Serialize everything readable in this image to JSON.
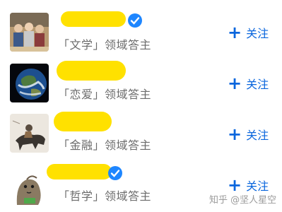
{
  "users": [
    {
      "tag": "「文学」领域答主",
      "verified": true
    },
    {
      "tag": "「恋爱」领域答主",
      "verified": false
    },
    {
      "tag": "「金融」领域答主",
      "verified": false
    },
    {
      "tag": "「哲学」领域答主",
      "verified": true
    }
  ],
  "follow_label": "关注",
  "follow_icon": "+",
  "watermark": "知乎 @坚人星空",
  "colors": {
    "accent": "#0a66dd",
    "highlight": "#ffe100",
    "verified": "#1e86ff"
  }
}
